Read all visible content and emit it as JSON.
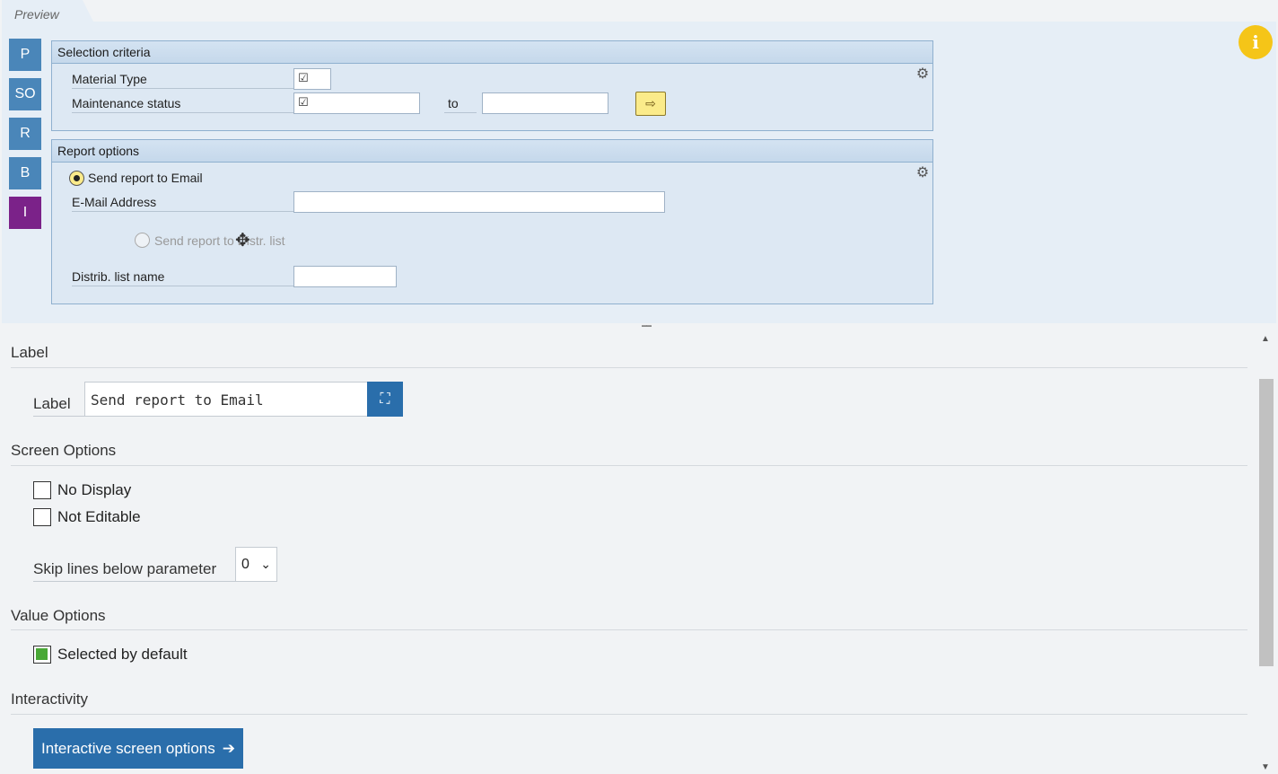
{
  "preview": {
    "tab_label": "Preview"
  },
  "sidenav": [
    {
      "label": "P"
    },
    {
      "label": "SO"
    },
    {
      "label": "R"
    },
    {
      "label": "B"
    },
    {
      "label": "I"
    }
  ],
  "info_icon": "info-icon",
  "selection_criteria": {
    "title": "Selection criteria",
    "material_type_label": "Material Type",
    "maintenance_status_label": "Maintenance status",
    "to_label": "to",
    "checkmark": "☑"
  },
  "report_options": {
    "title": "Report options",
    "send_email_label": "Send report to Email",
    "email_address_label": "E-Mail Address",
    "send_distr_label": "Send report to Distr. list",
    "distr_list_name_label": "Distrib. list name"
  },
  "label_section": {
    "title": "Label",
    "caption": "Label",
    "value": "Send report to Email"
  },
  "screen_options": {
    "title": "Screen Options",
    "no_display": "No Display",
    "not_editable": "Not Editable",
    "skip_lines_label": "Skip lines below parameter",
    "skip_lines_value": "0"
  },
  "value_options": {
    "title": "Value Options",
    "selected_by_default": "Selected by default"
  },
  "interactivity": {
    "title": "Interactivity",
    "button_label": "Interactive screen options"
  },
  "colors": {
    "accent": "#2a6eab",
    "nav_blue": "#4a86b9",
    "nav_purple": "#7b2289",
    "info_yellow": "#f5c518",
    "check_green": "#49a836"
  }
}
